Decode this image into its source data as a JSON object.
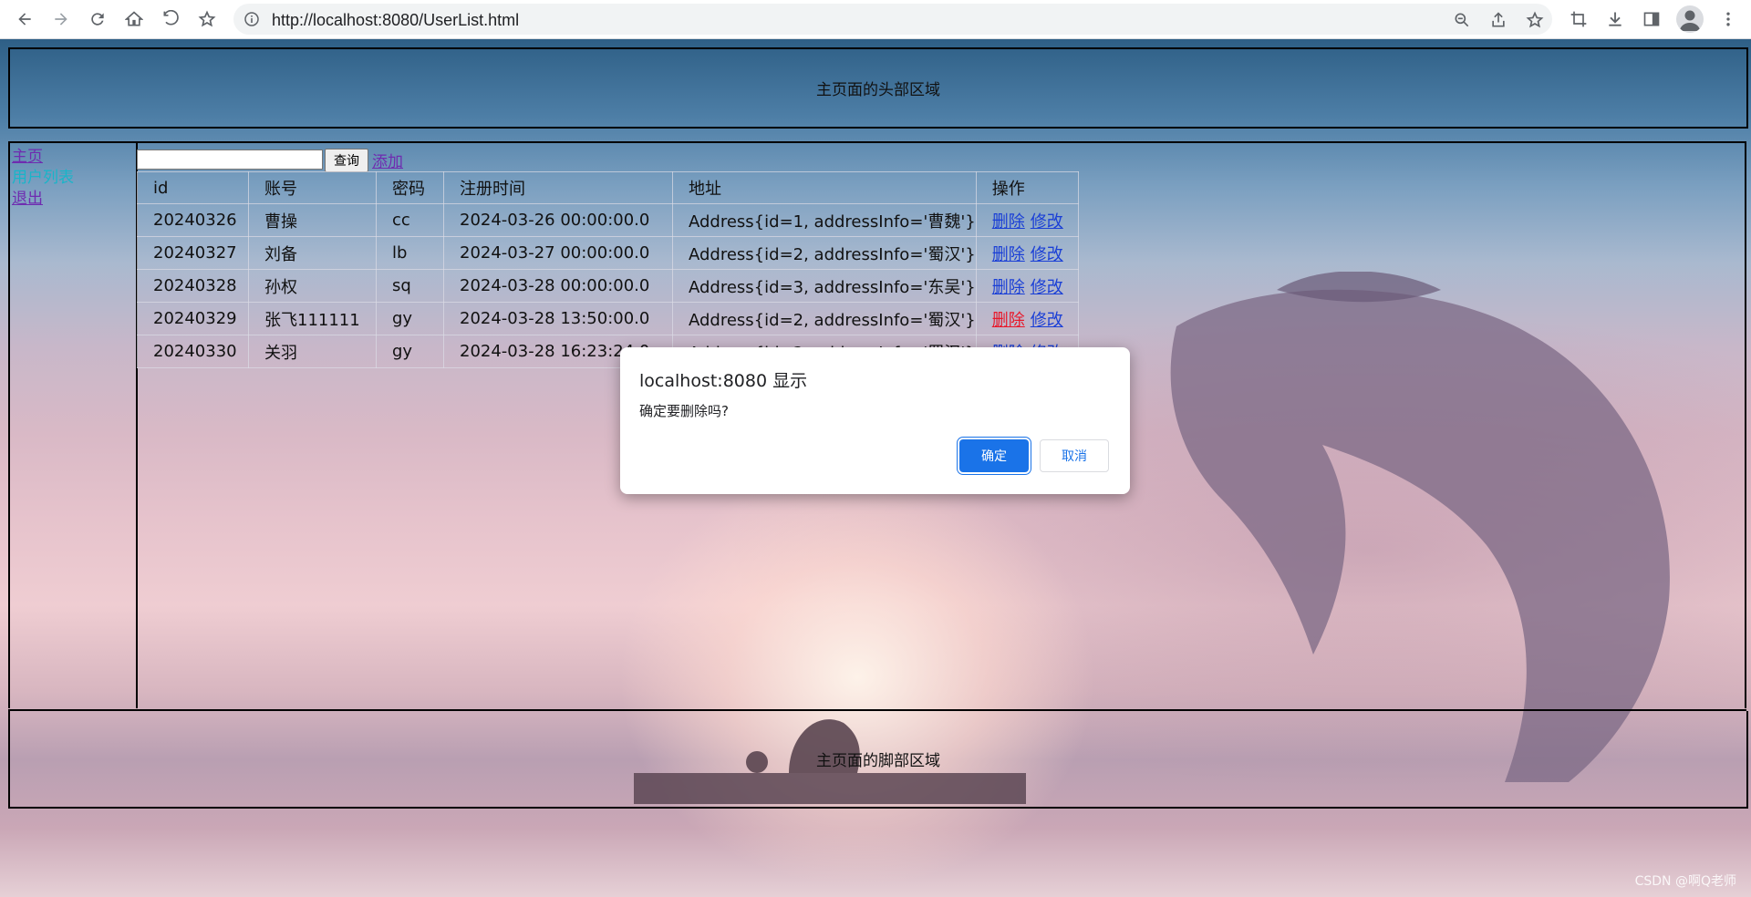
{
  "browser": {
    "url": "http://localhost:8080/UserList.html"
  },
  "page": {
    "header_text": "主页面的头部区域",
    "footer_text": "主页面的脚部区域",
    "sidebar": {
      "home": "主页",
      "user_list": "用户列表",
      "logout": "退出"
    },
    "search": {
      "value": "",
      "button": "查询",
      "add_link": "添加"
    },
    "table": {
      "headers": [
        "id",
        "账号",
        "密码",
        "注册时间",
        "地址",
        "操作"
      ],
      "rows": [
        {
          "id": "20240326",
          "account": "曹操",
          "password": "cc",
          "reg_time": "2024-03-26 00:00:00.0",
          "address": "Address{id=1, addressInfo='曹魏'}"
        },
        {
          "id": "20240327",
          "account": "刘备",
          "password": "lb",
          "reg_time": "2024-03-27 00:00:00.0",
          "address": "Address{id=2, addressInfo='蜀汉'}"
        },
        {
          "id": "20240328",
          "account": "孙权",
          "password": "sq",
          "reg_time": "2024-03-28 00:00:00.0",
          "address": "Address{id=3, addressInfo='东吴'}"
        },
        {
          "id": "20240329",
          "account": "张飞111111",
          "password": "gy",
          "reg_time": "2024-03-28 13:50:00.0",
          "address": "Address{id=2, addressInfo='蜀汉'}"
        },
        {
          "id": "20240330",
          "account": "关羽",
          "password": "gy",
          "reg_time": "2024-03-28 16:23:24.0",
          "address": "Address{id=2, addressInfo='蜀汉'}"
        }
      ],
      "delete_label": "删除",
      "edit_label": "修改"
    }
  },
  "dialog": {
    "title": "localhost:8080 显示",
    "message": "确定要删除吗?",
    "ok": "确定",
    "cancel": "取消"
  },
  "watermark": "CSDN @啊Q老师",
  "colors": {
    "dialog_primary": "#1a73e8",
    "link": "#1a3fd6",
    "visited_link": "#6f2cb0",
    "active_link": "#e8182a"
  }
}
